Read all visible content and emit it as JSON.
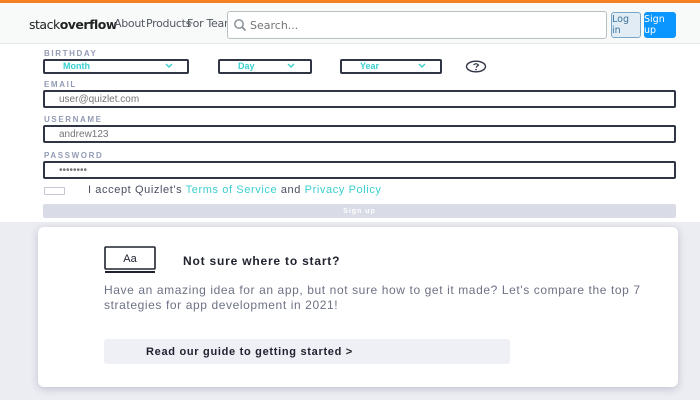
{
  "topbar": {
    "logo_light": "stack",
    "logo_bold": "overflow",
    "nav": [
      "About",
      "Products",
      "For Teams"
    ],
    "search_placeholder": "Search...",
    "login_label": "Log in",
    "signup_label": "Sign up",
    "accent_color": "#f48024"
  },
  "form": {
    "birthday_label": "BIRTHDAY",
    "month": "Month",
    "day": "Day",
    "year": "Year",
    "email_label": "EMAIL",
    "email_placeholder": "user@quizlet.com",
    "username_label": "USERNAME",
    "username_placeholder": "andrew123",
    "password_label": "PASSWORD",
    "password_placeholder": "••••••••",
    "terms_prefix": "I accept Quizlet's ",
    "terms_link": "Terms of Service",
    "terms_and": " and ",
    "privacy_link": "Privacy Policy",
    "signup_button": "Sign up",
    "accent_color": "#3ccfcf"
  },
  "card": {
    "title": "Not sure where to start?",
    "body": "Have an amazing idea for an app, but not sure how to get it made? Let's compare the top 7 strategies for app development in 2021!",
    "button": "Read our guide to getting started >",
    "icon_text": "Aa"
  }
}
